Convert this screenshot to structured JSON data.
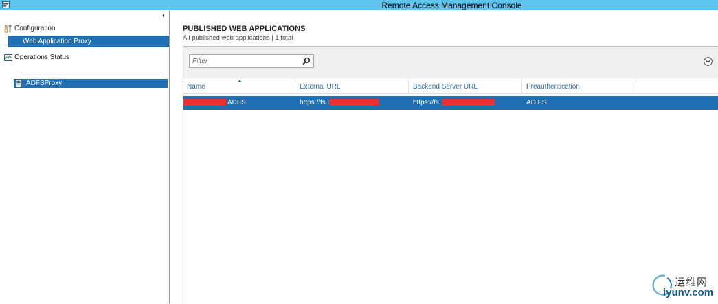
{
  "window": {
    "title": "Remote Access Management Console"
  },
  "sidebar": {
    "configuration_label": "Configuration",
    "web_application_proxy_label": "Web Application Proxy",
    "operations_status_label": "Operations Status",
    "server_label": "ADFSProxy"
  },
  "main": {
    "heading": "PUBLISHED WEB APPLICATIONS",
    "subheading": "All published web applications | 1 total",
    "filter_placeholder": "Filter",
    "columns": {
      "name": "Name",
      "external_url": "External URL",
      "backend_url": "Backend Server URL",
      "preauth": "Preauthentication"
    },
    "rows": [
      {
        "name": "ADFS",
        "external_url": "https://fs.i",
        "backend_url": "https://fs.",
        "preauth": "AD FS"
      }
    ]
  },
  "watermark": {
    "chinese": "运维网",
    "url": "iyunv.com"
  },
  "colors": {
    "titlebar": "#5ec4eb",
    "selection": "#1f6fb2",
    "header_text": "#2a6b9c",
    "redaction": "#f0302e"
  }
}
